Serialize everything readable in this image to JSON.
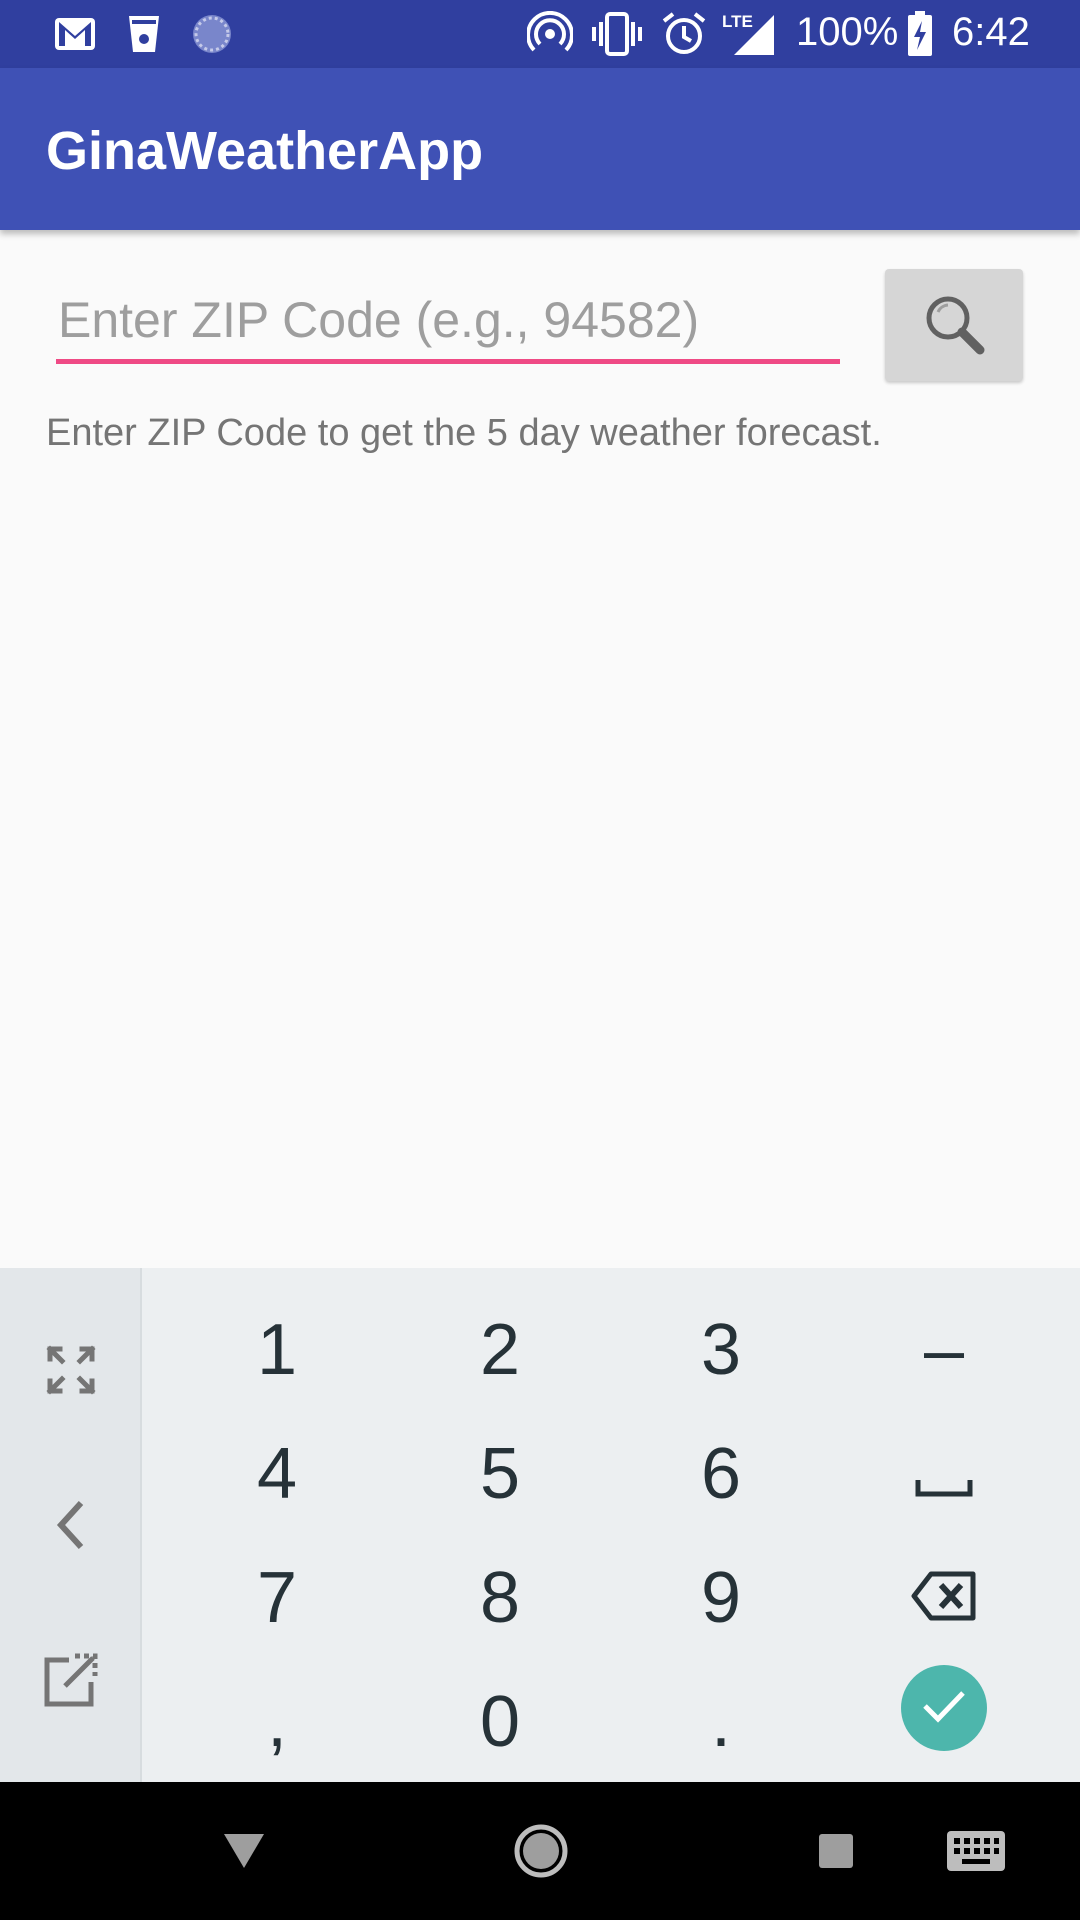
{
  "status_bar": {
    "battery": "100%",
    "time": "6:42",
    "network": "LTE",
    "icons": [
      "gmail-icon",
      "cup-icon",
      "sync-icon",
      "hotspot-icon",
      "vibrate-icon",
      "alarm-icon",
      "signal-icon",
      "battery-charging-icon"
    ]
  },
  "app_bar": {
    "title": "GinaWeatherApp"
  },
  "main": {
    "zip_placeholder": "Enter ZIP Code (e.g., 94582)",
    "zip_value": "",
    "search_icon": "search-icon",
    "hint": "Enter ZIP Code to get the 5 day weather forecast."
  },
  "keyboard": {
    "side_buttons": [
      "expand-icon",
      "back-chevron-icon",
      "popout-icon"
    ],
    "keys": {
      "k1": "1",
      "k2": "2",
      "k3": "3",
      "dash": "–",
      "k4": "4",
      "k5": "5",
      "k6": "6",
      "space": "␣",
      "k7": "7",
      "k8": "8",
      "k9": "9",
      "backspace": "backspace-icon",
      "comma": ",",
      "k0": "0",
      "period": ".",
      "enter": "check-icon"
    }
  },
  "nav_bar": {
    "buttons": [
      "back-icon",
      "home-icon",
      "recents-icon",
      "keyboard-icon"
    ]
  },
  "colors": {
    "status_bar": "#303f9f",
    "app_bar": "#3f51b5",
    "accent": "#ef4a85",
    "enter_key": "#4db6ac"
  }
}
